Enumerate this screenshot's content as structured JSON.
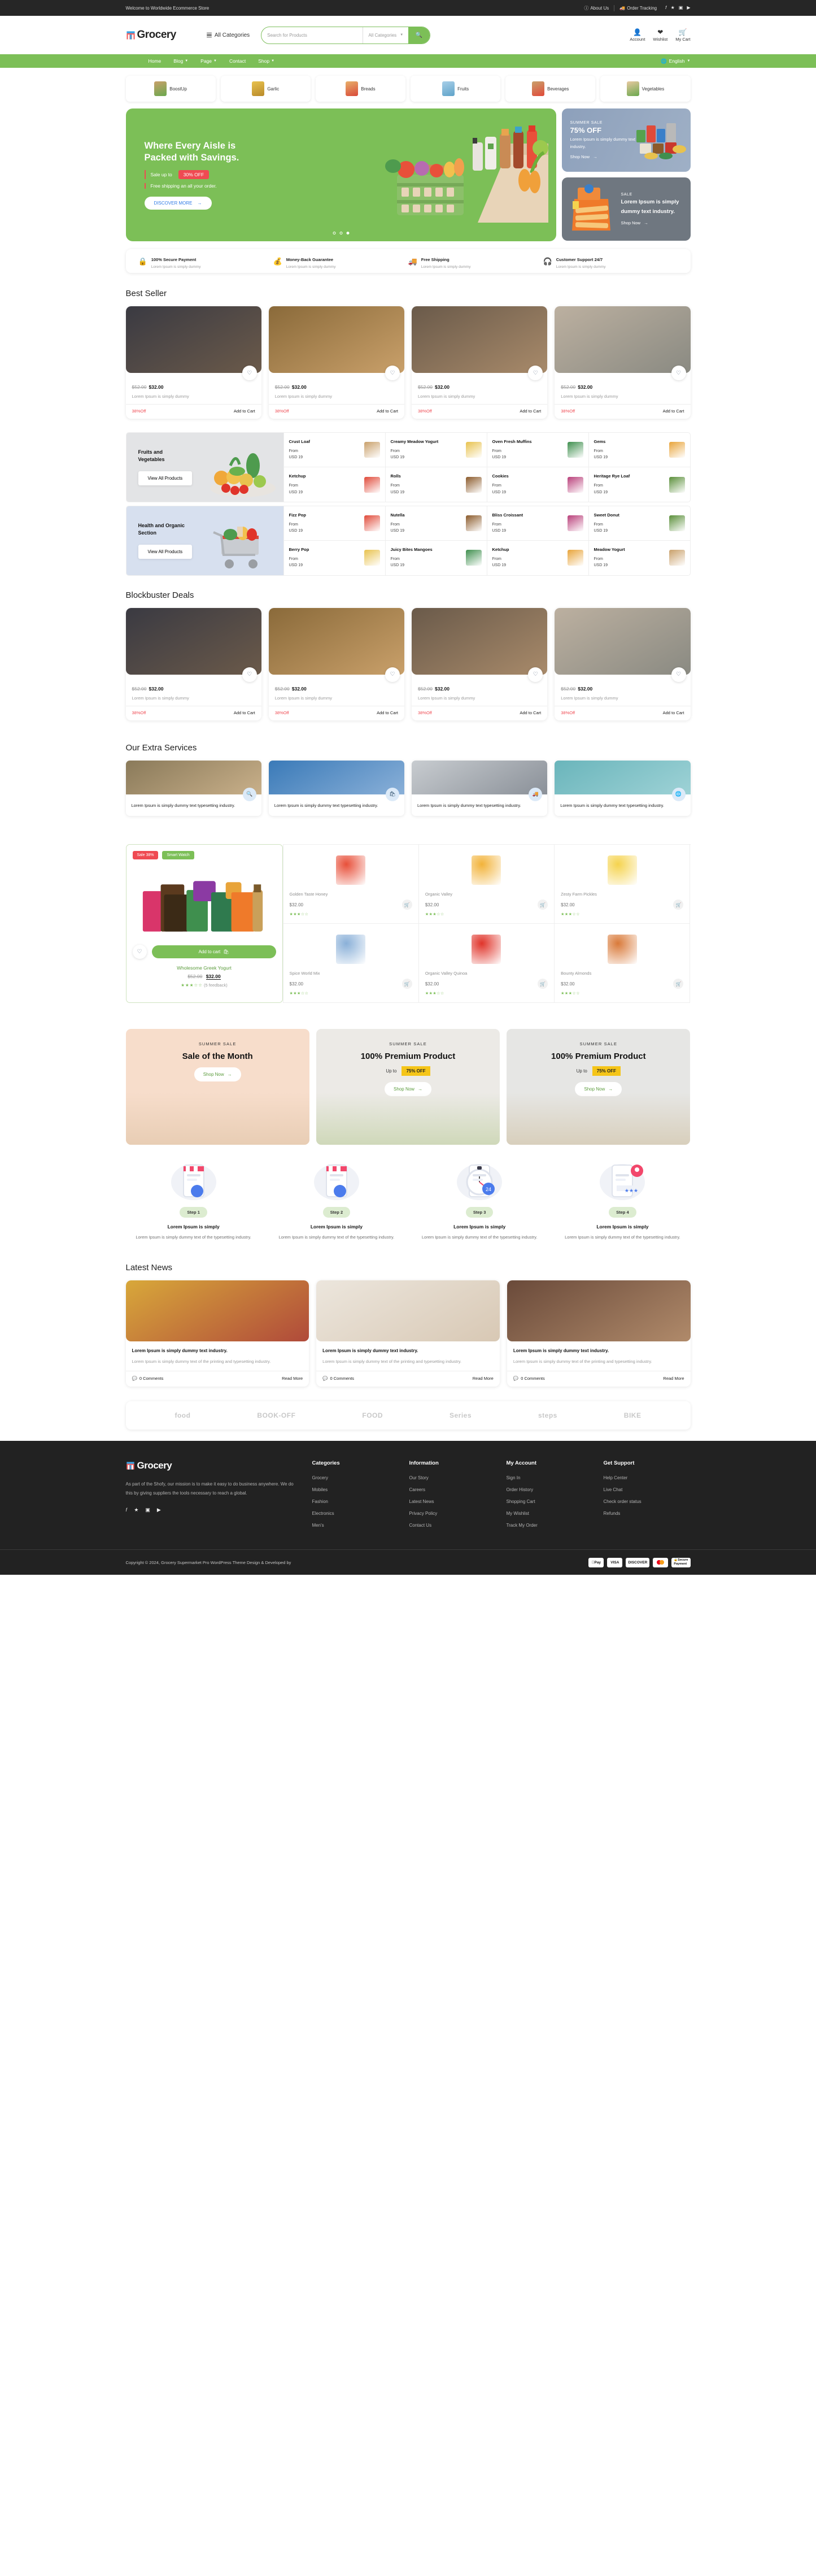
{
  "topbar": {
    "welcome": "Welcome to Worldwide Ecommerce Store",
    "about": "About Us",
    "tracking": "Order Tracking",
    "social": [
      "f",
      "t",
      "ig",
      "yt"
    ]
  },
  "header": {
    "brand": "Grocery",
    "all_categories": "All Categories",
    "search_placeholder": "Search for Products",
    "search_value": "",
    "category_select": "All Categories",
    "actions": [
      {
        "label": "Account",
        "icon": "user-icon"
      },
      {
        "label": "Wishlist",
        "icon": "heart-icon"
      },
      {
        "label": "My Cart",
        "icon": "cart-icon"
      }
    ]
  },
  "nav": {
    "items": [
      "Home",
      "Blog",
      "Page",
      "Contact",
      "Shop"
    ],
    "language": "English"
  },
  "categories": [
    {
      "label": "BoostUp"
    },
    {
      "label": "Garlic"
    },
    {
      "label": "Breads"
    },
    {
      "label": "Fruits"
    },
    {
      "label": "Beverages"
    },
    {
      "label": "Vegetables"
    }
  ],
  "hero": {
    "title_line1": "Where Every Aisle is",
    "title_line2": "Packed with Savings.",
    "sale_label": "Sale up to",
    "sale_badge": "30% OFF",
    "shipping": "Free shipping an all your order.",
    "cta": "DISCOVER MORE",
    "dots": 3,
    "active_dot": 3
  },
  "side_banners": [
    {
      "kicker": "SUMMER SALE",
      "headline": "75% OFF",
      "text": "Lorem Ipsum is simply dummy text industry.",
      "cta": "Shop Now"
    },
    {
      "kicker": "SALE",
      "headline": "Lorem Ipsum is simply dummy text industry.",
      "text": "",
      "cta": "Shop Now"
    }
  ],
  "usps": [
    {
      "title": "100% Secure Payment",
      "sub": "Lorem Ipsum is simply dummy",
      "icon": "lock-bag-icon"
    },
    {
      "title": "Money-Back Guarantee",
      "sub": "Lorem Ipsum is simply dummy",
      "icon": "coins-icon"
    },
    {
      "title": "Free Shipping",
      "sub": "Lorem Ipsum is simply dummy",
      "icon": "truck-icon"
    },
    {
      "title": "Customer Support 24/7",
      "sub": "Lorem Ipsum is simply dummy",
      "icon": "headset-icon"
    }
  ],
  "best_seller": {
    "title": "Best Seller",
    "products": [
      {
        "old_price": "$52.00",
        "price": "$32.00",
        "desc": "Lorem Ipsum is simply dummy",
        "off": "38%Off",
        "cta": "Add to Cart"
      },
      {
        "old_price": "$52.00",
        "price": "$32.00",
        "desc": "Lorem Ipsum is simply dummy",
        "off": "38%Off",
        "cta": "Add to Cart"
      },
      {
        "old_price": "$52.00",
        "price": "$32.00",
        "desc": "Lorem Ipsum is simply dummy",
        "off": "38%Off",
        "cta": "Add to Cart"
      },
      {
        "old_price": "$52.00",
        "price": "$32.00",
        "desc": "Lorem Ipsum is simply dummy",
        "off": "38%Off",
        "cta": "Add to Cart"
      }
    ]
  },
  "cat_blocks": [
    {
      "title_line1": "Fruits and",
      "title_line2": "Vegetables",
      "cta": "View All Products",
      "columns": [
        [
          {
            "name": "Crust Loaf",
            "from": "From",
            "price": "USD 19"
          },
          {
            "name": "Ketchup",
            "from": "From",
            "price": "USD 19"
          }
        ],
        [
          {
            "name": "Creamy Meadow Yogurt",
            "from": "From",
            "price": "USD 19"
          },
          {
            "name": "Rolls",
            "from": "From",
            "price": "USD 19"
          }
        ],
        [
          {
            "name": "Oven Fresh Muffins",
            "from": "From",
            "price": "USD 19"
          },
          {
            "name": "Cookies",
            "from": "From",
            "price": "USD 19"
          }
        ],
        [
          {
            "name": "Gems",
            "from": "From",
            "price": "USD 19"
          },
          {
            "name": "Heritage Rye Loaf",
            "from": "From",
            "price": "USD 19"
          }
        ]
      ]
    },
    {
      "title_line1": "Health and Organic",
      "title_line2": "Section",
      "cta": "View All Products",
      "columns": [
        [
          {
            "name": "Fizz Pop",
            "from": "From",
            "price": "USD 19"
          },
          {
            "name": "Berry Pop",
            "from": "From",
            "price": "USD 19"
          }
        ],
        [
          {
            "name": "Nutella",
            "from": "From",
            "price": "USD 19"
          },
          {
            "name": "Juicy Bites Mangoes",
            "from": "From",
            "price": "USD 19"
          }
        ],
        [
          {
            "name": "Bliss Croissant",
            "from": "From",
            "price": "USD 19"
          },
          {
            "name": "Ketchup",
            "from": "From",
            "price": "USD 19"
          }
        ],
        [
          {
            "name": "Sweet Donut",
            "from": "From",
            "price": "USD 19"
          },
          {
            "name": "Meadow Yogurt",
            "from": "From",
            "price": "USD 19"
          }
        ]
      ]
    }
  ],
  "blockbuster": {
    "title": "Blockbuster Deals",
    "products": [
      {
        "old_price": "$52.00",
        "price": "$32.00",
        "desc": "Lorem Ipsum is simply dummy",
        "off": "38%Off",
        "cta": "Add to Cart"
      },
      {
        "old_price": "$52.00",
        "price": "$32.00",
        "desc": "Lorem Ipsum is simply dummy",
        "off": "38%Off",
        "cta": "Add to Cart"
      },
      {
        "old_price": "$52.00",
        "price": "$32.00",
        "desc": "Lorem Ipsum is simply dummy",
        "off": "38%Off",
        "cta": "Add to Cart"
      },
      {
        "old_price": "$52.00",
        "price": "$32.00",
        "desc": "Lorem Ipsum is simply dummy",
        "off": "38%Off",
        "cta": "Add to Cart"
      }
    ]
  },
  "services": {
    "title": "Our Extra Services",
    "items": [
      {
        "text": "Lorem Ipsum is simply dummy text typesetting industry.",
        "icon": "search-icon"
      },
      {
        "text": "Lorem Ipsum is simply dummy text typesetting industry.",
        "icon": "bag-icon"
      },
      {
        "text": "Lorem Ipsum is simply dummy text typesetting industry.",
        "icon": "truck-icon"
      },
      {
        "text": "Lorem Ipsum is simply dummy text typesetting industry.",
        "icon": "globe-icon"
      }
    ]
  },
  "deal": {
    "tag_sale": "Sale 38%",
    "tag_name": "Smart Watch",
    "add_to_cart": "Add to cart",
    "product_name": "Wholesome Greek Yogurt",
    "old_price": "$52.00",
    "price": "$32.00",
    "rating": 3,
    "feedback": "(5 feedback)",
    "grid": [
      {
        "name": "Golden Taste Honey",
        "price": "$32.00",
        "rating": 3
      },
      {
        "name": "Organic Valley",
        "price": "$32.00",
        "rating": 3
      },
      {
        "name": "Zesty Farm Pickles",
        "price": "$32.00",
        "rating": 3
      },
      {
        "name": "Spice World Mix",
        "price": "$32.00",
        "rating": 3
      },
      {
        "name": "Organic Valley Quinoa",
        "price": "$32.00",
        "rating": 3
      },
      {
        "name": "Bounty Almonds",
        "price": "$32.00",
        "rating": 3
      }
    ]
  },
  "summer_sale": [
    {
      "kicker": "SUMMER SALE",
      "headline": "Sale of the Month",
      "upto": "",
      "percent": "",
      "cta": "Shop Now"
    },
    {
      "kicker": "SUMMER SALE",
      "headline": "100% Premium Product",
      "upto": "Up to",
      "percent": "75% OFF",
      "cta": "Shop Now"
    },
    {
      "kicker": "SUMMER SALE",
      "headline": "100% Premium Product",
      "upto": "Up to",
      "percent": "75% OFF",
      "cta": "Shop Now"
    }
  ],
  "steps": [
    {
      "badge": "Step 1",
      "title": "Lorem Ipsum is simply",
      "text": "Lorem Ipsum is simply dummy text of the typesetting industry."
    },
    {
      "badge": "Step 2",
      "title": "Lorem Ipsum is simply",
      "text": "Lorem Ipsum is simply dummy text of the typesetting industry."
    },
    {
      "badge": "Step 3",
      "title": "Lorem Ipsum is simply",
      "text": "Lorem Ipsum is simply dummy text of the typesetting industry."
    },
    {
      "badge": "Step 4",
      "title": "Lorem Ipsum is simply",
      "text": "Lorem Ipsum is simply dummy text of the typesetting industry."
    }
  ],
  "news": {
    "title": "Latest News",
    "posts": [
      {
        "title": "Lorem Ipsum is simply dummy text industry.",
        "excerpt": "Lorem Ipsum is simply dummy text of the printing and typesetting industry.",
        "comments": "0 Comments",
        "read": "Read More"
      },
      {
        "title": "Lorem Ipsum is simply dummy text industry.",
        "excerpt": "Lorem Ipsum is simply dummy text of the printing and typesetting industry.",
        "comments": "0 Comments",
        "read": "Read More"
      },
      {
        "title": "Lorem Ipsum is simply dummy text industry.",
        "excerpt": "Lorem Ipsum is simply dummy text of the printing and typesetting industry.",
        "comments": "0 Comments",
        "read": "Read More"
      }
    ]
  },
  "brands": [
    "food",
    "BOOK-OFF",
    "FOOD",
    "Series",
    "steps",
    "BIKE"
  ],
  "footer": {
    "brand": "Grocery",
    "about": "As part of the Shofy, our mission is to make it easy to do business anywhere. We do this by giving suppliers the tools necessary to reach a global.",
    "columns": [
      {
        "title": "Categories",
        "links": [
          "Grocery",
          "Mobiles",
          "Fashion",
          "Electronics",
          "Men's"
        ]
      },
      {
        "title": "Information",
        "links": [
          "Our Story",
          "Careers",
          "Latest News",
          "Privacy Policy",
          "Contact Us"
        ]
      },
      {
        "title": "My Account",
        "links": [
          "Sign In",
          "Order History",
          "Shopping Cart",
          "My Wishlist",
          "Track My Order"
        ]
      },
      {
        "title": "Get Support",
        "links": [
          "Help Center",
          "Live Chat",
          "Check order status",
          "Refunds"
        ]
      }
    ],
    "copyright": "Copyright © 2024, Grocery Supermarket Pro WordPress Theme Design & Developed by",
    "payments": [
      "Pay",
      "VISA",
      "DISCOVER",
      "mastercard",
      "Secure Payment"
    ]
  },
  "colors": {
    "green": "#7cbf57",
    "red": "#ef4a52",
    "dark": "#222222",
    "orange": "#f7921e",
    "yellow": "#f5c518"
  }
}
